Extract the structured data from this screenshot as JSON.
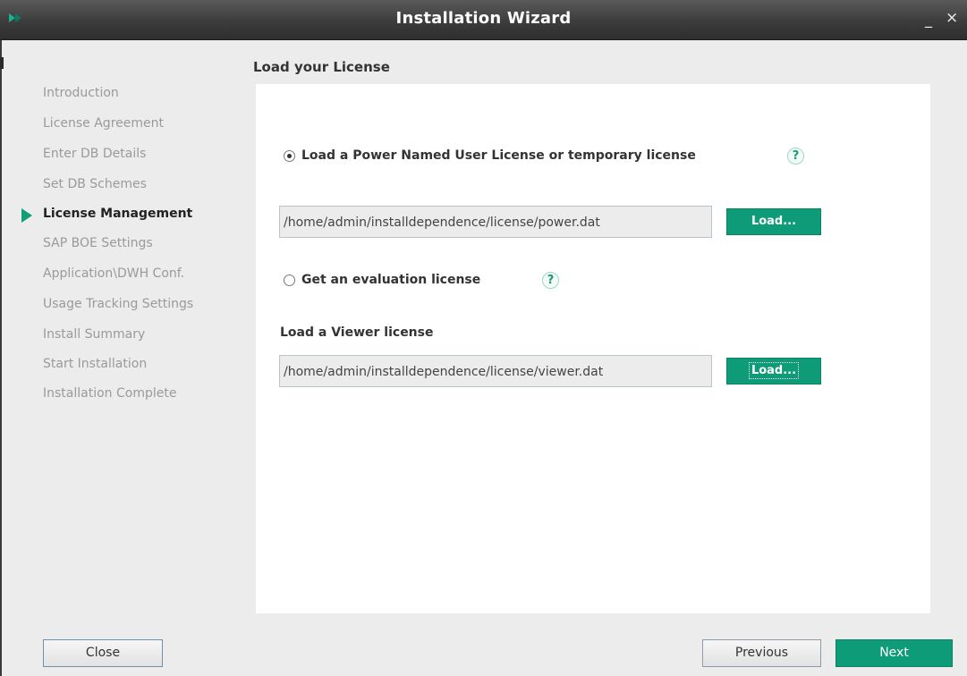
{
  "window": {
    "title": "Installation Wizard",
    "minimize_label": "_",
    "close_label": "×"
  },
  "sidebar": {
    "steps": [
      {
        "label": "Introduction",
        "current": false
      },
      {
        "label": "License Agreement",
        "current": false
      },
      {
        "label": "Enter DB Details",
        "current": false
      },
      {
        "label": "Set DB Schemes",
        "current": false
      },
      {
        "label": "License Management",
        "current": true
      },
      {
        "label": "SAP BOE Settings",
        "current": false
      },
      {
        "label": "Application\\DWH Conf.",
        "current": false
      },
      {
        "label": "Usage Tracking Settings",
        "current": false
      },
      {
        "label": "Install Summary",
        "current": false
      },
      {
        "label": "Start Installation",
        "current": false
      },
      {
        "label": "Installation Complete",
        "current": false
      }
    ]
  },
  "main": {
    "heading": "Load your License",
    "option_power": {
      "label": "Load a Power Named User License or temporary license",
      "selected": true,
      "help": "?"
    },
    "power_path": "/home/admin/installdependence/license/power.dat",
    "load_label": "Load...",
    "option_eval": {
      "label": "Get an evaluation license",
      "selected": false,
      "help": "?"
    },
    "viewer_heading": "Load a Viewer license",
    "viewer_path": "/home/admin/installdependence/license/viewer.dat"
  },
  "footer": {
    "close_label": "Close",
    "previous_label": "Previous",
    "next_label": "Next"
  },
  "colors": {
    "accent": "#0e9b78",
    "titlebar": "#3c3c3c",
    "inactive_step": "#9a9a9a"
  }
}
